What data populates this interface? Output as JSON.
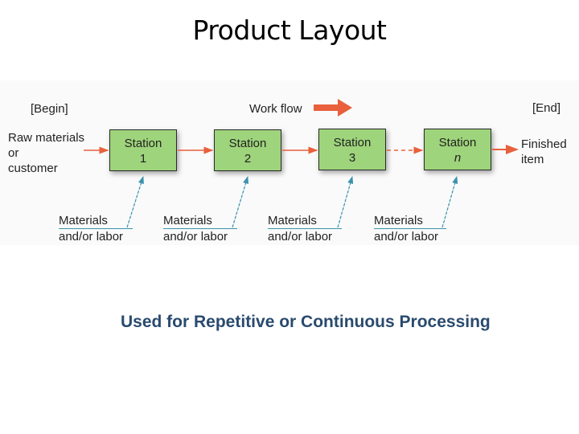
{
  "title": "Product Layout",
  "diagram": {
    "begin_label": "[Begin]",
    "end_label": "[End]",
    "workflow_label": "Work flow",
    "input": {
      "line1": "Raw materials",
      "line2": "or",
      "line3": "customer"
    },
    "output": {
      "line1": "Finished",
      "line2": "item"
    },
    "stations": [
      {
        "label": "Station",
        "number": "1"
      },
      {
        "label": "Station",
        "number": "2"
      },
      {
        "label": "Station",
        "number": "3"
      },
      {
        "label": "Station",
        "number": "n"
      }
    ],
    "inputs_to_stations": [
      {
        "line1": "Materials",
        "line2": "and/or labor"
      },
      {
        "line1": "Materials",
        "line2": "and/or labor"
      },
      {
        "line1": "Materials",
        "line2": "and/or labor"
      },
      {
        "line1": "Materials",
        "line2": "and/or labor"
      }
    ],
    "colors": {
      "station_fill": "#9ed47b",
      "flow_arrow": "#e8603c",
      "input_arrow": "#3a93ad"
    }
  },
  "subtitle": "Used for Repetitive or Continuous Processing"
}
